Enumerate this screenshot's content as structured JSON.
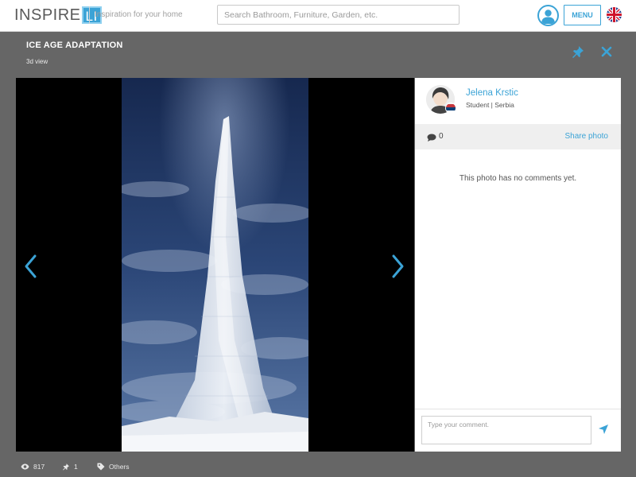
{
  "header": {
    "logo_text": "INSPIRE",
    "logo_box_text": "LI",
    "tagline": "Inspiration for your home",
    "search_placeholder": "Search Bathroom, Furniture, Garden, etc.",
    "menu_label": "MENU",
    "icons": [
      "user-icon",
      "uk-flag-icon"
    ]
  },
  "photo": {
    "title": "ICE AGE ADAPTATION",
    "subtitle": "3d view",
    "icons": [
      "pin-icon",
      "close-icon",
      "chevron-left-icon",
      "chevron-right-icon"
    ]
  },
  "author": {
    "name": "Jelena Krstic",
    "role": "Student | Serbia"
  },
  "comments": {
    "count": "0",
    "share_label": "Share photo",
    "empty_message": "This photo has no comments yet.",
    "input_placeholder": "Type your comment."
  },
  "footer": {
    "views": "817",
    "pins": "1",
    "category": "Others"
  },
  "colors": {
    "accent": "#3ba3d6",
    "background": "#666666",
    "viewer": "#000000"
  }
}
